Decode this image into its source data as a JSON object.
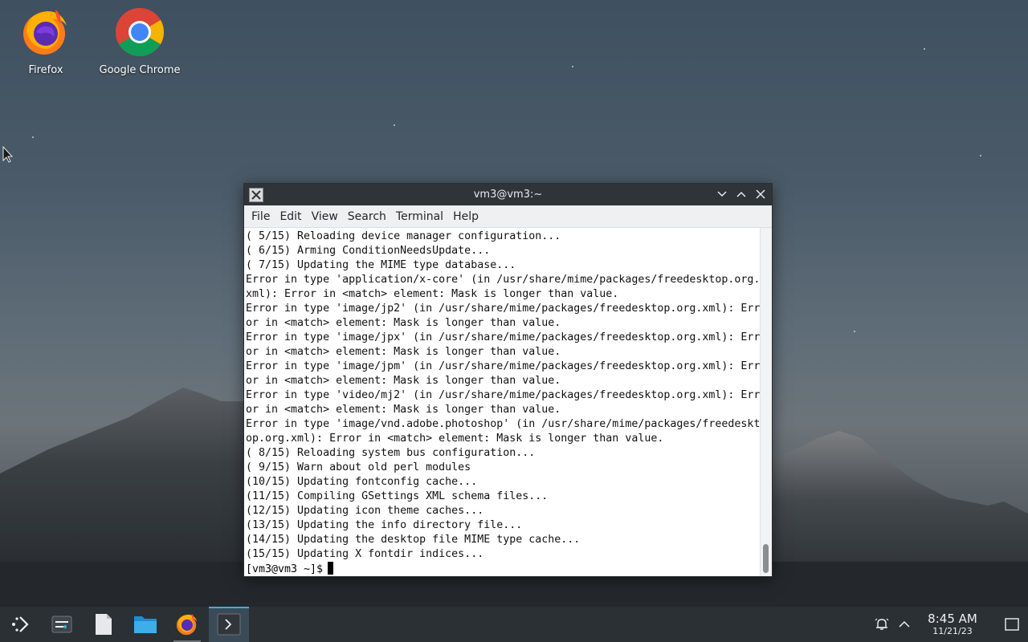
{
  "desktop": {
    "icons": [
      {
        "label": "Firefox",
        "icon": "firefox-icon"
      },
      {
        "label": "Google Chrome",
        "icon": "chrome-icon"
      }
    ]
  },
  "terminal": {
    "title": "vm3@vm3:~",
    "menu": [
      "File",
      "Edit",
      "View",
      "Search",
      "Terminal",
      "Help"
    ],
    "lines": [
      "( 5/15) Reloading device manager configuration...",
      "( 6/15) Arming ConditionNeedsUpdate...",
      "( 7/15) Updating the MIME type database...",
      "Error in type 'application/x-core' (in /usr/share/mime/packages/freedesktop.org.",
      "xml): Error in <match> element: Mask is longer than value.",
      "Error in type 'image/jp2' (in /usr/share/mime/packages/freedesktop.org.xml): Err",
      "or in <match> element: Mask is longer than value.",
      "Error in type 'image/jpx' (in /usr/share/mime/packages/freedesktop.org.xml): Err",
      "or in <match> element: Mask is longer than value.",
      "Error in type 'image/jpm' (in /usr/share/mime/packages/freedesktop.org.xml): Err",
      "or in <match> element: Mask is longer than value.",
      "Error in type 'video/mj2' (in /usr/share/mime/packages/freedesktop.org.xml): Err",
      "or in <match> element: Mask is longer than value.",
      "Error in type 'image/vnd.adobe.photoshop' (in /usr/share/mime/packages/freedeskt",
      "op.org.xml): Error in <match> element: Mask is longer than value.",
      "( 8/15) Reloading system bus configuration...",
      "( 9/15) Warn about old perl modules",
      "(10/15) Updating fontconfig cache...",
      "(11/15) Compiling GSettings XML schema files...",
      "(12/15) Updating icon theme caches...",
      "(13/15) Updating the info directory file...",
      "(14/15) Updating the desktop file MIME type cache...",
      "(15/15) Updating X fontdir indices..."
    ],
    "prompt": "[vm3@vm3 ~]$"
  },
  "taskbar": {
    "items": [
      "application-launcher-icon",
      "pager-icon",
      "text-editor-icon",
      "file-manager-icon",
      "firefox-icon",
      "konsole-icon"
    ],
    "clock": {
      "time": "8:45 AM",
      "date": "11/21/23"
    }
  },
  "colors": {
    "accent": "#3daee9",
    "panel": "#2b3035",
    "titlebar": "#2f3439"
  }
}
